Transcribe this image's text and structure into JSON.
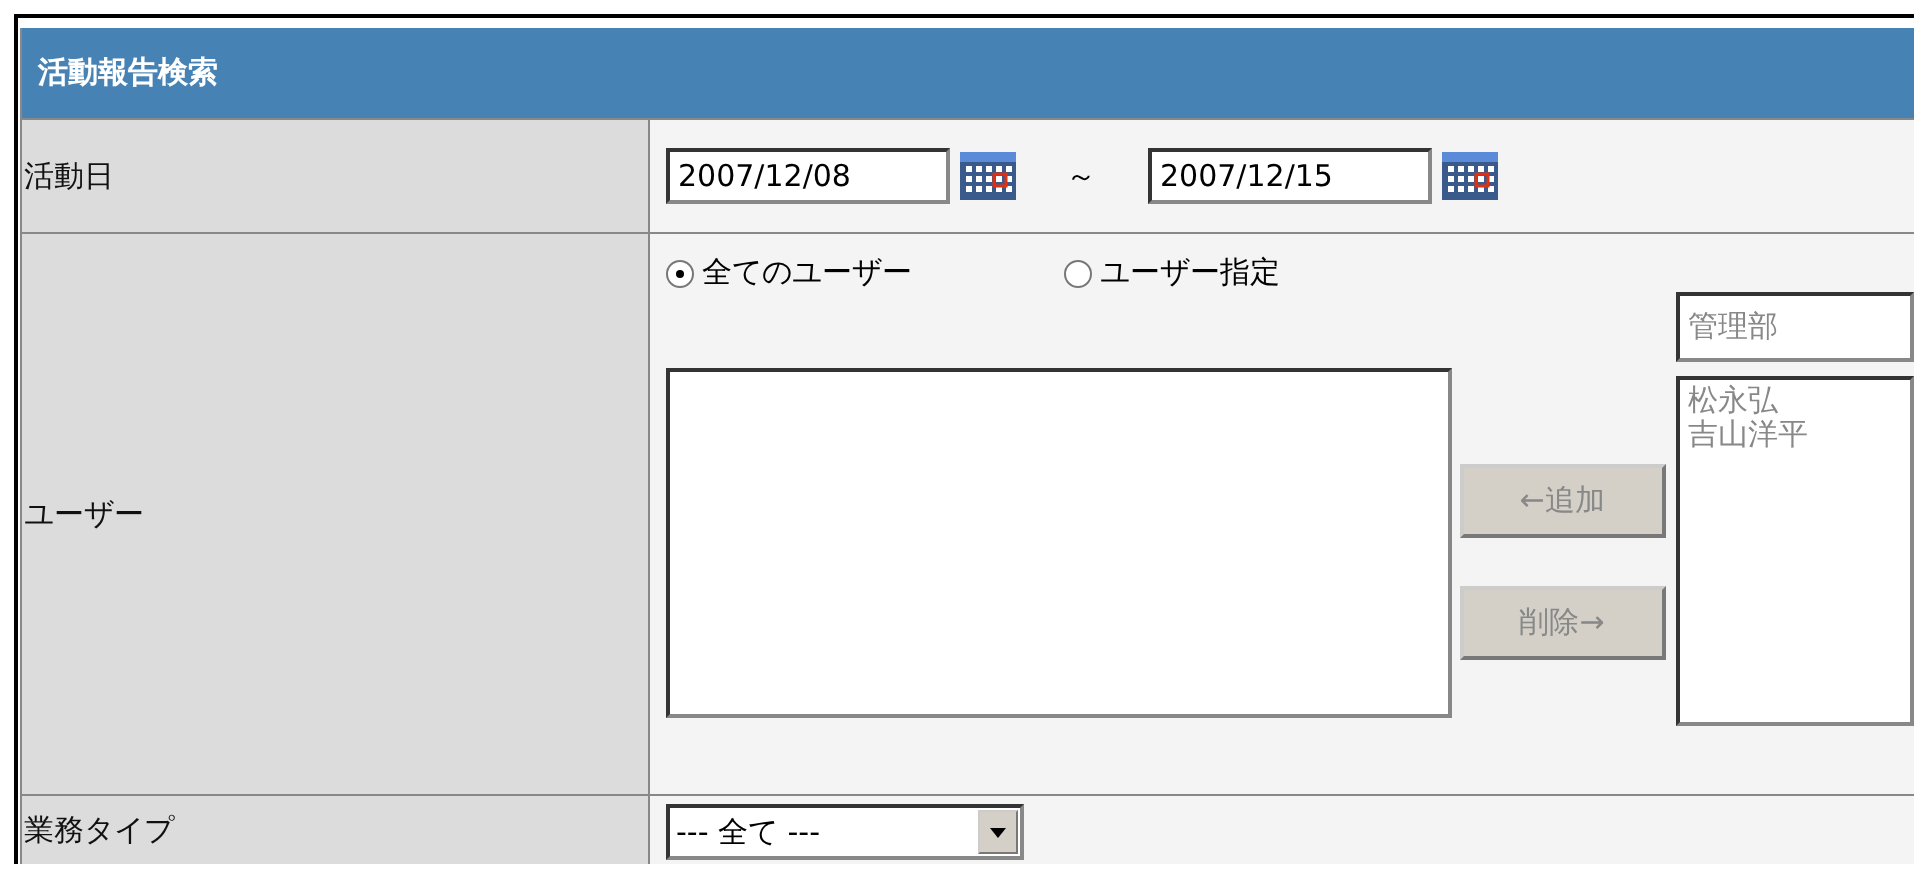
{
  "title": "活動報告検索",
  "rows": [
    {
      "kind": "daterange",
      "label": "活動日",
      "from": "2007/12/08",
      "separator": "～",
      "to": "2007/12/15"
    },
    {
      "kind": "users",
      "label": "ユーザー",
      "radios": [
        {
          "label": "全てのユーザー",
          "selected": true
        },
        {
          "label": "ユーザー指定",
          "selected": false
        }
      ],
      "department": "管理部",
      "candidates": [
        "松永弘",
        "吉山洋平"
      ],
      "buttons": [
        {
          "label": "←追加",
          "disabled": true
        },
        {
          "label": "削除→",
          "disabled": true
        }
      ],
      "picker_disabled": true
    },
    {
      "kind": "select",
      "label": "業務タイプ",
      "value": "--- 全て ---"
    }
  ]
}
